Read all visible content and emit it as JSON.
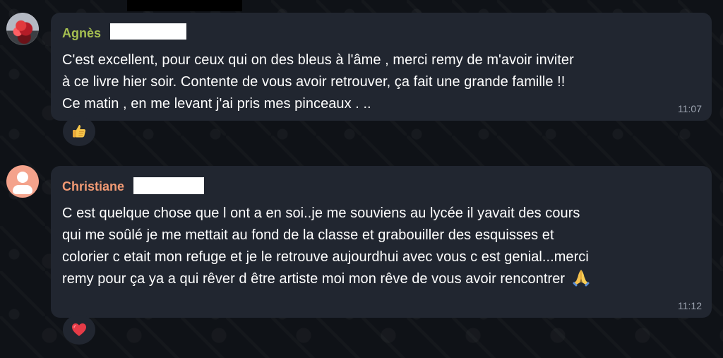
{
  "messages": [
    {
      "sender": "Agnès",
      "text_lines": [
        "C'est excellent,  pour ceux qui on des bleus à  l'âme , merci  remy  de m'avoir inviter",
        "à  ce livre hier soir.  Contente de vous avoir retrouver, ça  fait une grande famille !!",
        "Ce matin , en me levant j'ai  pris mes pinceaux . .."
      ],
      "time": "11:07",
      "reaction": "thumbs-up"
    },
    {
      "sender": "Christiane",
      "text_lines": [
        "C est quelque chose que l ont a en soi..je me souviens au lycée il yavait des cours",
        "qui me soûlé je me mettait au fond de la classe et grabouiller des esquisses et",
        "colorier c etait mon refuge et je le retrouve aujourdhui avec vous c est genial...merci",
        "remy pour ça ya a qui rêver d être artiste moi mon  rêve de vous avoir rencontrer"
      ],
      "trailing_icon": "praying-hands-icon",
      "time": "11:12",
      "reaction": "red-heart"
    }
  ],
  "colors": {
    "bubble": "#212630",
    "agnes_name": "#a5bf50",
    "christiane_name": "#f29a74",
    "timestamp": "#9ca3af"
  }
}
